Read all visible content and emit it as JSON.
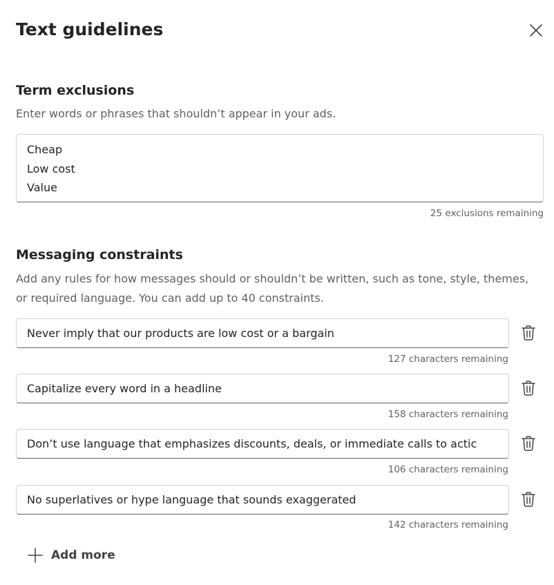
{
  "panel": {
    "title": "Text guidelines"
  },
  "icons": {
    "close": "close-icon",
    "delete": "trash-icon",
    "add": "plus-icon"
  },
  "term_exclusions": {
    "heading": "Term exclusions",
    "description": "Enter words or phrases that shouldn’t appear in your ads.",
    "terms": [
      "Cheap",
      "Low cost",
      "Value"
    ],
    "remaining": "25 exclusions remaining"
  },
  "messaging_constraints": {
    "heading": "Messaging constraints",
    "description": "Add any rules for how messages should or shouldn’t be written, such as tone, style, themes, or required language. You can add up to 40 constraints.",
    "items": [
      {
        "value": "Never imply that our products are low cost or a bargain",
        "remaining": "127 characters remaining"
      },
      {
        "value": "Capitalize every word in a headline",
        "remaining": "158 characters remaining"
      },
      {
        "value": "Don’t use language that emphasizes discounts, deals, or immediate calls to actic",
        "remaining": "106 characters remaining"
      },
      {
        "value": "No superlatives or hype language that sounds exaggerated",
        "remaining": "142 characters remaining"
      }
    ],
    "add_more_label": "Add more"
  },
  "colors": {
    "text_primary": "#242424",
    "text_secondary": "#616161",
    "border": "#d1d1d1",
    "border_bottom": "#616161"
  }
}
